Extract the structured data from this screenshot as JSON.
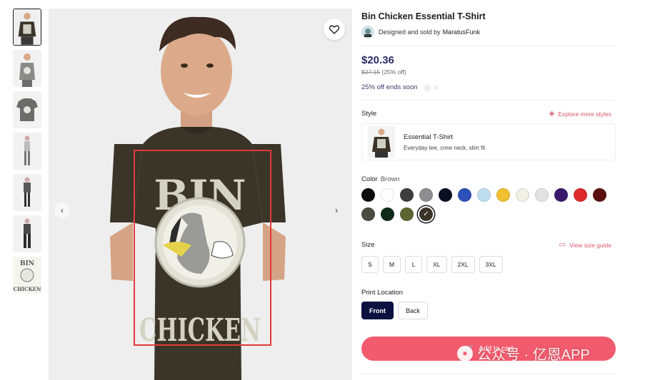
{
  "product": {
    "title": "Bin Chicken Essential T-Shirt",
    "seller_prefix": "Designed and sold by",
    "seller_name": "MaratusFunk"
  },
  "pricing": {
    "price": "$20.36",
    "old_price": "$27.15",
    "discount": "(25% off)",
    "promo": "25% off ends soon"
  },
  "style": {
    "label": "Style",
    "explore_link": "Explore more styles",
    "name": "Essential T-Shirt",
    "description": "Everyday tee, crew neck, slim fit"
  },
  "color": {
    "label": "Color",
    "selected": "Brown",
    "swatches": [
      "#0d0d0d",
      "#ffffff",
      "#3d3d3f",
      "#8e8e90",
      "#0b0f24",
      "#2d4fb8",
      "#bfdff0",
      "#f0c030",
      "#f3f1e6",
      "#e2e2e2",
      "#3b1a6e",
      "#de2a2a",
      "#5a0e0e",
      "#4b4b44",
      "#0f2a18",
      "#5e6533",
      "#3b3429"
    ],
    "selected_index": 16
  },
  "size": {
    "label": "Size",
    "guide_link": "View size guide",
    "options": [
      "S",
      "M",
      "L",
      "XL",
      "2XL",
      "3XL"
    ]
  },
  "print_location": {
    "label": "Print Location",
    "options": [
      "Front",
      "Back"
    ],
    "selected": "Front"
  },
  "cart": {
    "label": "Add to cart"
  },
  "design": {
    "top_text": "BIN",
    "bottom_text": "CHICKEN"
  },
  "watermark": {
    "text": "公众号 · 亿恩APP"
  },
  "icons": {
    "favorite": "heart-icon",
    "prev": "chevron-left-icon",
    "next": "chevron-right-icon",
    "explore": "cube-icon",
    "size_guide": "ruler-icon",
    "cart": "cart-icon"
  },
  "colors": {
    "accent": "#f25a6d",
    "price": "#2b2b66",
    "selected_location": "#0d1140",
    "shirt": "#3b3429"
  }
}
